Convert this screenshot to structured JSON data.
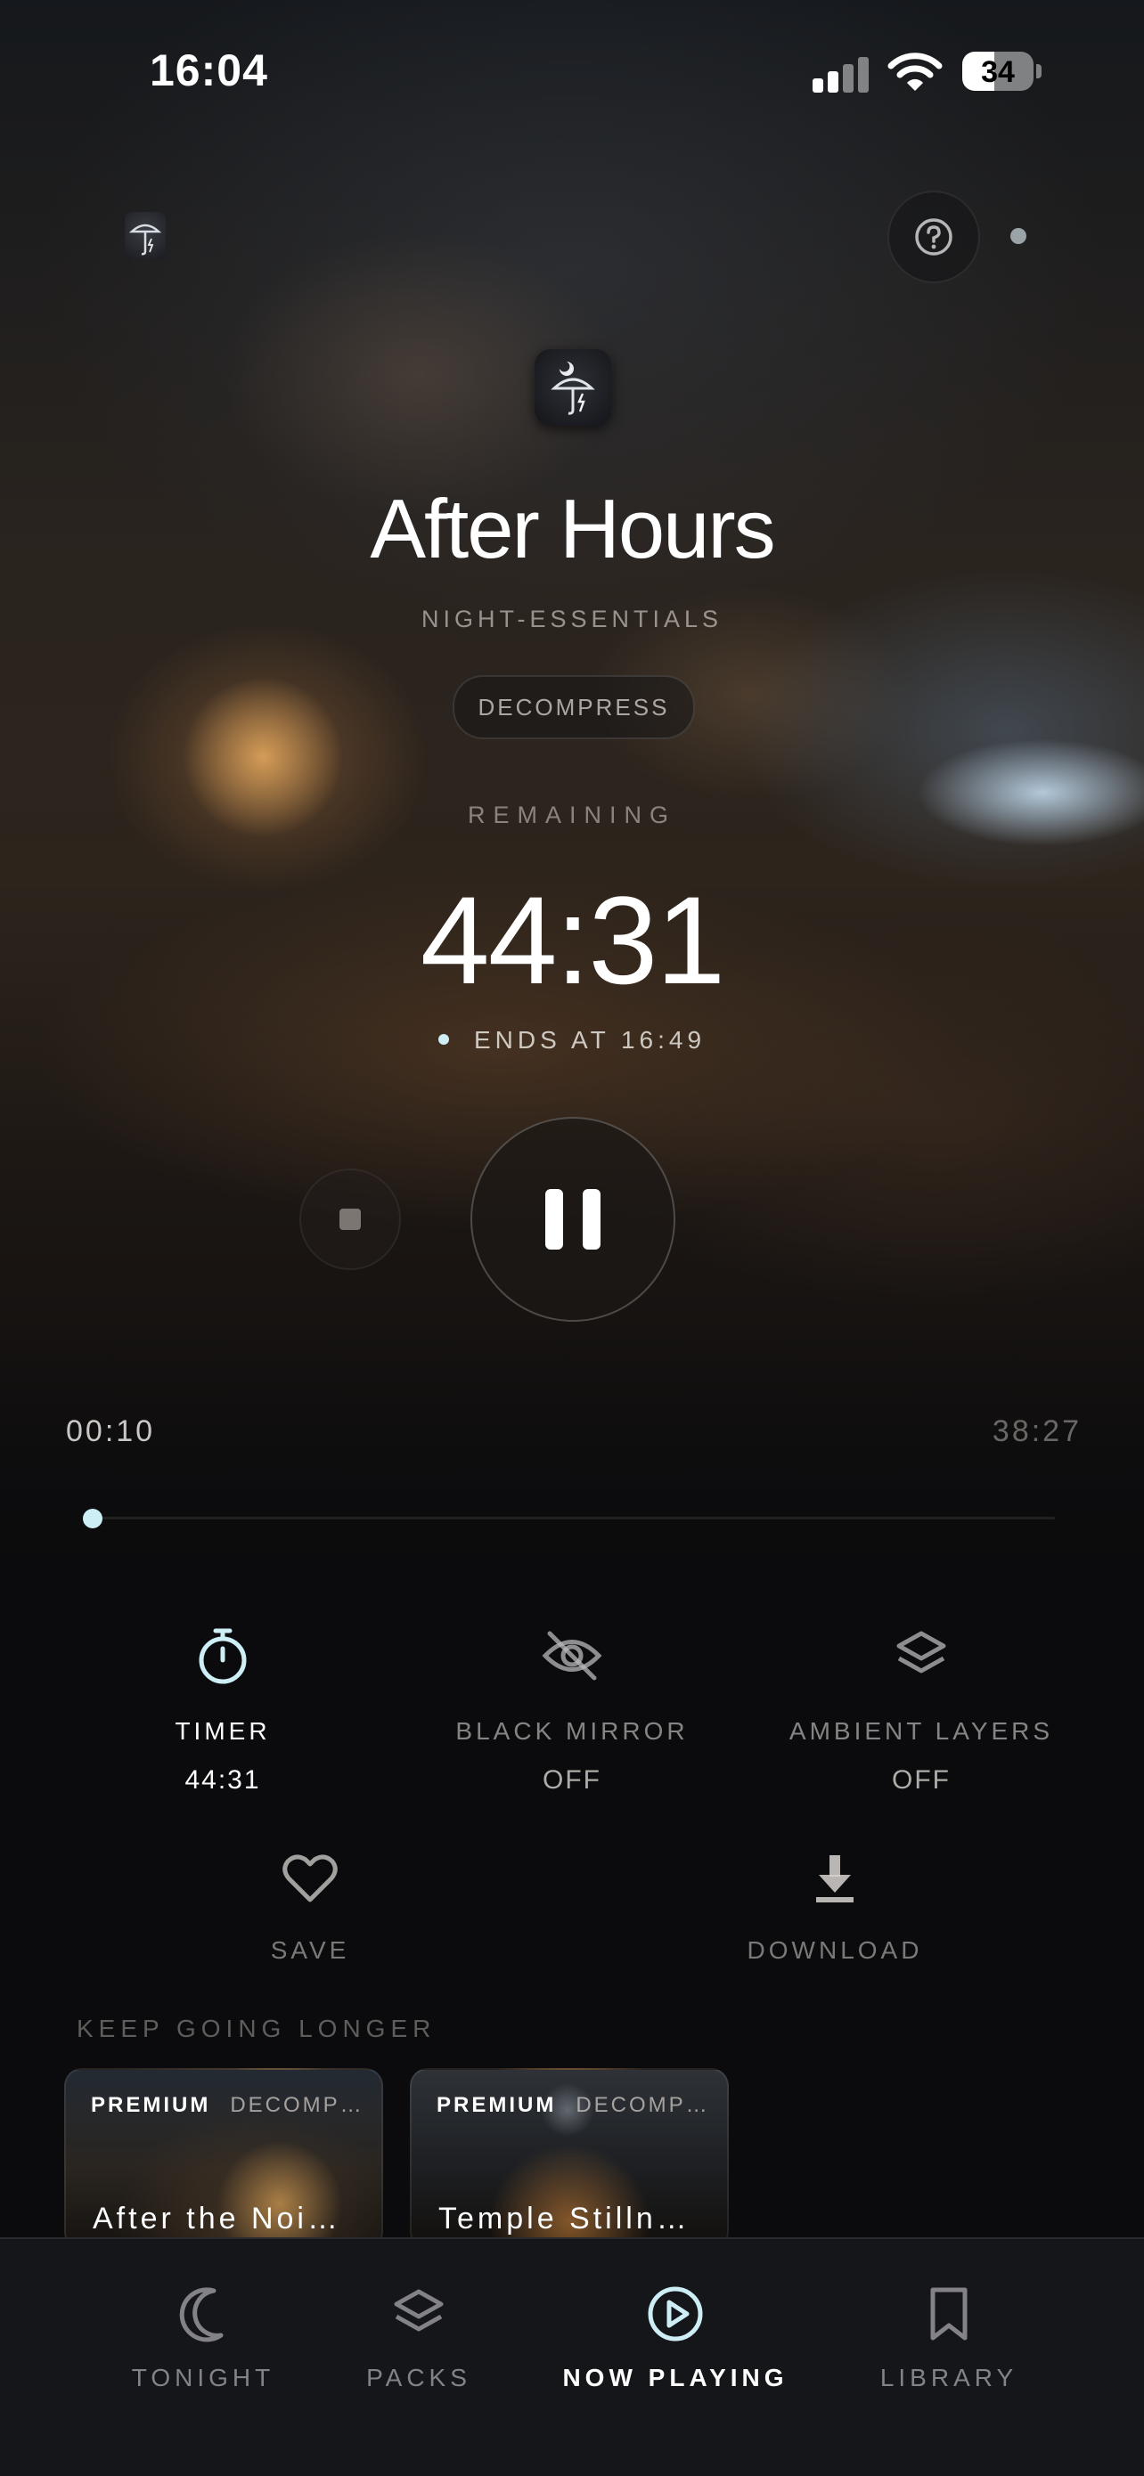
{
  "status_bar": {
    "time": "16:04",
    "battery": "34"
  },
  "header": {
    "help_icon": "question-circle-icon"
  },
  "session": {
    "title": "After Hours",
    "pack": "NIGHT-ESSENTIALS",
    "mood": "DECOMPRESS",
    "remaining_label": "REMAINING",
    "countdown": "44:31",
    "ends_at": "ENDS AT 16:49"
  },
  "playback": {
    "elapsed": "00:10",
    "total": "38:27",
    "progress_fraction": 0.004,
    "state": "playing"
  },
  "controls": [
    {
      "icon": "stopwatch-icon",
      "label": "TIMER",
      "value": "44:31",
      "active": true
    },
    {
      "icon": "eye-off-icon",
      "label": "BLACK MIRROR",
      "value": "OFF",
      "active": false
    },
    {
      "icon": "layers-icon",
      "label": "AMBIENT LAYERS",
      "value": "OFF",
      "active": false
    }
  ],
  "actions": {
    "save": {
      "icon": "heart-icon",
      "label": "SAVE"
    },
    "download": {
      "icon": "download-icon",
      "label": "DOWNLOAD"
    }
  },
  "recommendations": {
    "label": "KEEP GOING LONGER",
    "cards": [
      {
        "badge": "PREMIUM",
        "mood": "DECOMP…",
        "title": "After the Noi…"
      },
      {
        "badge": "PREMIUM",
        "mood": "DECOMP…",
        "title": "Temple Stilln…"
      }
    ]
  },
  "tabs": [
    {
      "icon": "moon-icon",
      "label": "TONIGHT"
    },
    {
      "icon": "layers-icon",
      "label": "PACKS"
    },
    {
      "icon": "play-circle-icon",
      "label": "NOW PLAYING",
      "active": true
    },
    {
      "icon": "bookmark-icon",
      "label": "LIBRARY"
    }
  ],
  "colors": {
    "accent": "#cdeef5",
    "background": "#0b0b0d",
    "tabbar": "#15161a"
  }
}
